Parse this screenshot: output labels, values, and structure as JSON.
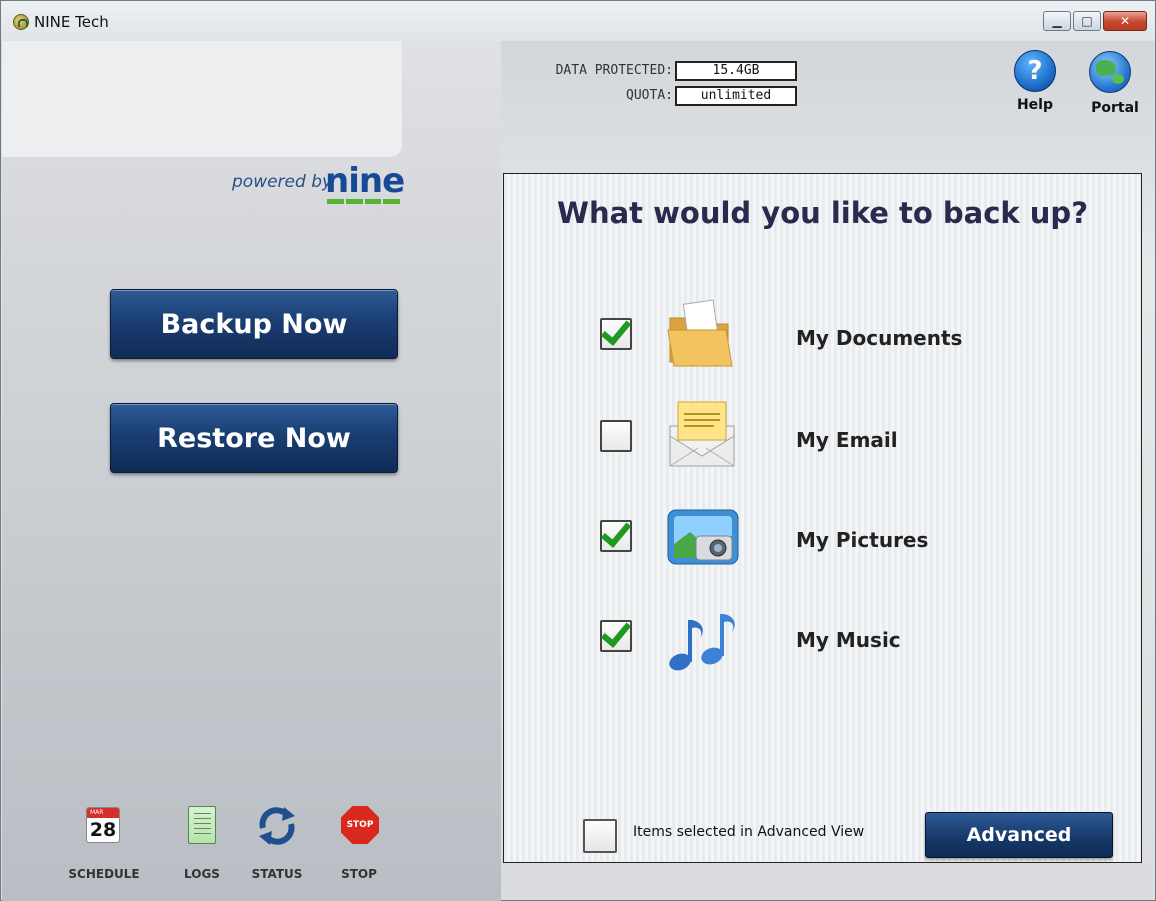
{
  "window": {
    "title": "NINE Tech",
    "minimize_glyph": "▁",
    "maximize_glyph": "□",
    "close_glyph": "✕"
  },
  "branding": {
    "powered_by": "powered by",
    "brand": "nine",
    "brand_color": "#164a96",
    "bar_color": "#58b236"
  },
  "stats": {
    "data_protected_label": "DATA PROTECTED:",
    "data_protected_value": "15.4GB",
    "quota_label": "QUOTA:",
    "quota_value": "unlimited"
  },
  "top_actions": {
    "help_label": "Help",
    "portal_label": "Portal"
  },
  "actions": {
    "backup_label": "Backup Now",
    "restore_label": "Restore Now",
    "button_color": "#1a3e72"
  },
  "tools": [
    {
      "label": "SCHEDULE",
      "icon": "calendar-icon",
      "calendar_month": "MAR",
      "calendar_day": "28"
    },
    {
      "label": "LOGS",
      "icon": "logs-icon"
    },
    {
      "label": "STATUS",
      "icon": "refresh-icon"
    },
    {
      "label": "STOP",
      "icon": "stop-sign-icon",
      "sign_text": "STOP"
    }
  ],
  "backup": {
    "question": "What would you like to back up?",
    "items": [
      {
        "label": "My Documents",
        "checked": true,
        "icon": "folder-icon"
      },
      {
        "label": "My Email",
        "checked": false,
        "icon": "envelope-icon"
      },
      {
        "label": "My Pictures",
        "checked": true,
        "icon": "camera-icon"
      },
      {
        "label": "My Music",
        "checked": true,
        "icon": "music-notes-icon"
      }
    ],
    "advanced_checkbox_label": "Items selected in Advanced View",
    "advanced_checked": false,
    "advanced_button_label": "Advanced"
  }
}
